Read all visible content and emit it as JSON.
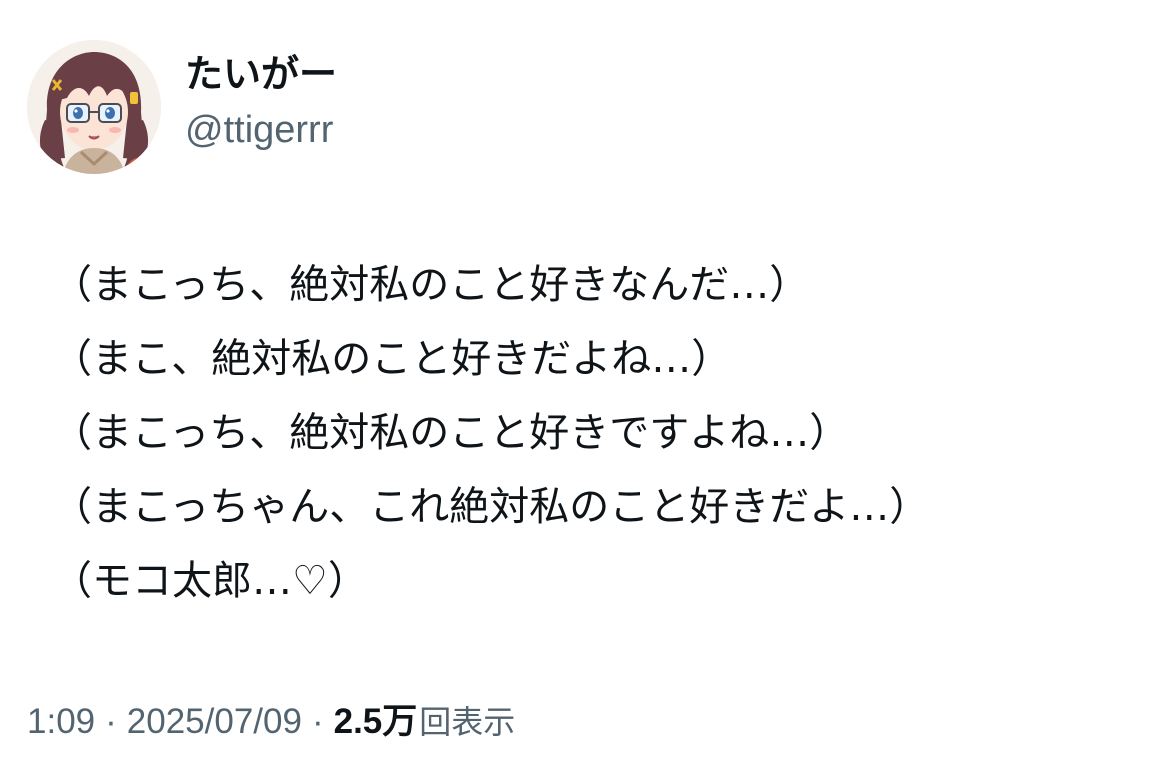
{
  "author": {
    "display_name": "たいがー",
    "handle": "@ttigerrr"
  },
  "tweet": {
    "lines": [
      "（まこっち、絶対私のこと好きなんだ…）",
      "（まこ、絶対私のこと好きだよね…）",
      "（まこっち、絶対私のこと好きですよね…）",
      "（まこっちゃん、これ絶対私のこと好きだよ…）",
      "（モコ太郎…♡）"
    ]
  },
  "meta": {
    "time": "1:09",
    "separator": "·",
    "date": "2025/07/09",
    "views_count": "2.5万",
    "views_label": "回表示"
  },
  "colors": {
    "text_primary": "#0f1419",
    "text_secondary": "#536471",
    "background": "#ffffff"
  },
  "icons": {
    "avatar": "anime-girl-avatar-image"
  }
}
